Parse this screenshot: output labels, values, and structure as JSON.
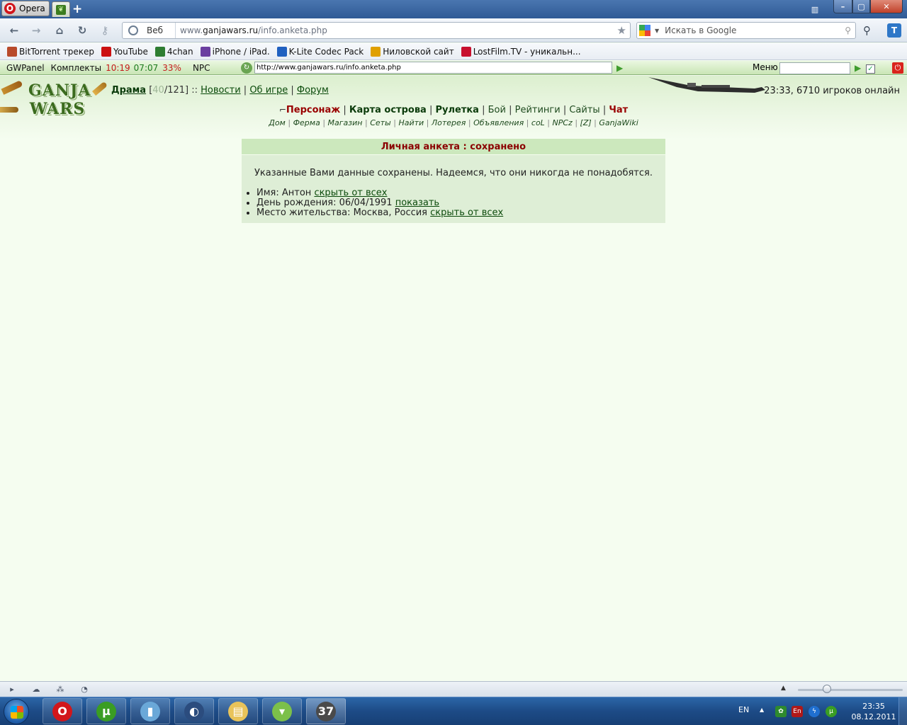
{
  "browser": {
    "menu_label": "Opera",
    "search_engine_label": "Веб",
    "url_prefix": "www.",
    "url_domain": "ganjawars.ru",
    "url_path": "/info.anketa.php",
    "search_placeholder": "Искать в Google",
    "toolbar_button_t": "T"
  },
  "bookmarks": [
    {
      "label": "BitTorrent трекер",
      "icon": "bittorrent-icon",
      "color": "#b84a2a"
    },
    {
      "label": "YouTube",
      "icon": "youtube-icon",
      "color": "#cc1111"
    },
    {
      "label": "4chan",
      "icon": "4chan-icon",
      "color": "#2e7d32"
    },
    {
      "label": "iPhone / iPad.",
      "icon": "iphone-icon",
      "color": "#6b3fa0"
    },
    {
      "label": "K-Lite Codec Pack",
      "icon": "klite-icon",
      "color": "#2060c0"
    },
    {
      "label": "Ниловской сайт",
      "icon": "smiley-icon",
      "color": "#e0a000"
    },
    {
      "label": "LostFilm.TV - уникальн...",
      "icon": "lostfilm-icon",
      "color": "#c8102e"
    }
  ],
  "gwpanel": {
    "label": "GWPanel",
    "sets_label": "Комплекты",
    "time1": "10:19",
    "time2": "07:07",
    "percent": "33%",
    "npc_label": "NPC",
    "url": "http://www.ganjawars.ru/info.anketa.php",
    "menu_label": "Меню",
    "check_mark": "✓"
  },
  "site": {
    "logo_top": "GANJA",
    "logo_bottom": "WARS",
    "user_link": "Драма",
    "hp_current": "40",
    "hp_max": "/121]",
    "hp_open": "[",
    "hp_sep": " ::",
    "news_link": "Новости",
    "about_link": "Об игре",
    "forum_link": "Форум",
    "online_text": "23:33, 6710 игроков онлайн",
    "main_nav": {
      "character": "Персонаж",
      "map": "Карта острова",
      "roulette": "Рулетка",
      "battle": "Бой",
      "ratings": "Рейтинги",
      "sites": "Сайты",
      "chat": "Чат"
    },
    "sub_nav": [
      "Дом",
      "Ферма",
      "Магазин",
      "Сеты",
      "Найти",
      "Лотерея",
      "Объявления",
      "coL",
      "NPCz",
      "[Z]",
      "GanjaWiki"
    ]
  },
  "card": {
    "title": "Личная анкета : сохранено",
    "message": "Указанные Вами данные сохранены. Надеемся, что они никогда не понадобятся.",
    "items": [
      {
        "text": "Имя: Антон",
        "link": "скрыть от всех"
      },
      {
        "text": "День рождения: 06/04/1991",
        "link": "показать"
      },
      {
        "text": "Место жительства: Москва, Россия",
        "link": "скрыть от всех"
      }
    ]
  },
  "taskbar": {
    "language": "EN",
    "keyboard_indicator": "En",
    "clock_time": "23:35",
    "clock_date": "08.12.2011",
    "apps": [
      {
        "name": "opera-task",
        "glyph": "O",
        "color": "#d2161b"
      },
      {
        "name": "utorrent-task",
        "glyph": "µ",
        "color": "#3a9d23"
      },
      {
        "name": "bottle-task",
        "glyph": "▮",
        "color": "#6aa8d8"
      },
      {
        "name": "globe-task",
        "glyph": "◐",
        "color": "#2b4c7e"
      },
      {
        "name": "explorer-task",
        "glyph": "▤",
        "color": "#e8c35a"
      },
      {
        "name": "glass-task",
        "glyph": "▾",
        "color": "#7cc04a"
      },
      {
        "name": "clapper-task",
        "glyph": "37",
        "color": "#4a4a4a"
      }
    ]
  }
}
